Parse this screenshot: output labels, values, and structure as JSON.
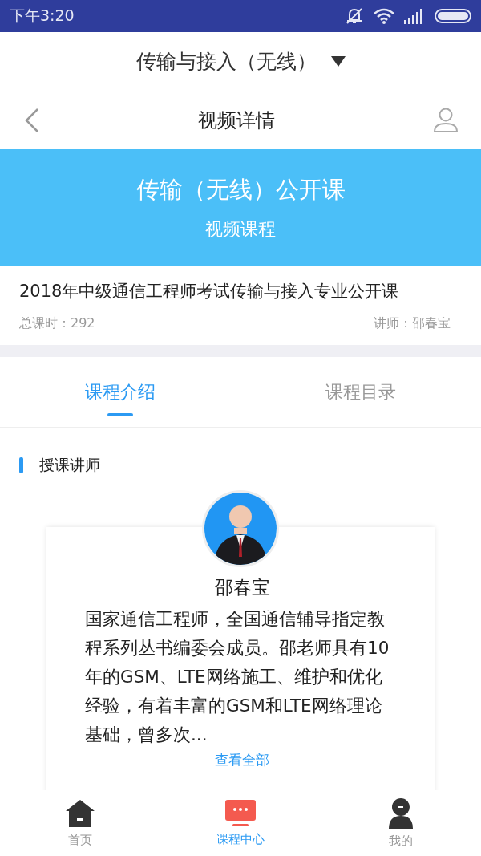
{
  "status_bar": {
    "time": "下午3:20"
  },
  "top_bar": {
    "title": "传输与接入（无线）"
  },
  "nav_bar": {
    "title": "视频详情"
  },
  "banner": {
    "title": "传输（无线）公开课",
    "subtitle": "视频课程"
  },
  "course": {
    "title": "2018年中级通信工程师考试传输与接入专业公开课",
    "hours": "总课时：292",
    "teacher": "讲师：邵春宝"
  },
  "tabs": [
    {
      "label": "课程介绍",
      "selected": true
    },
    {
      "label": "课程目录",
      "selected": false
    }
  ],
  "section": {
    "title": "授课讲师"
  },
  "lecturer": {
    "name": "邵春宝",
    "bio": "国家通信工程师，全国通信辅导指定教程系列丛书编委会成员。邵老师具有10年的GSM、LTE网络施工、维护和优化经验，有着丰富的GSM和LTE网络理论基础，曾多次...",
    "link": "查看全部"
  },
  "bottom_nav": [
    {
      "label": "首页",
      "kind": "home",
      "selected": false
    },
    {
      "label": "课程中心",
      "kind": "course",
      "selected": true
    },
    {
      "label": "我的",
      "kind": "profile",
      "selected": false
    }
  ]
}
